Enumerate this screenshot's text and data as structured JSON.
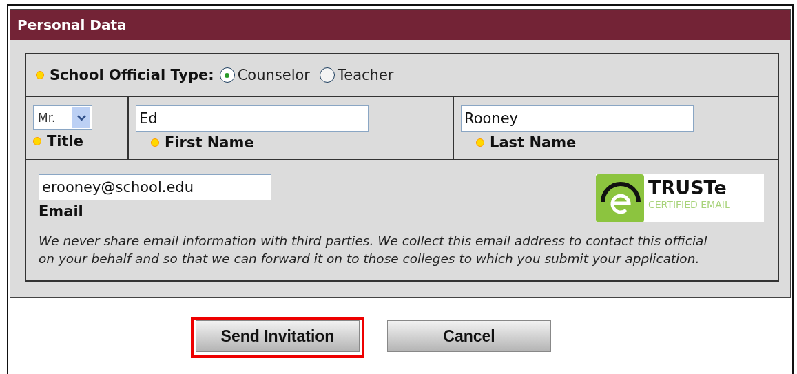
{
  "panel": {
    "title": "Personal Data"
  },
  "official_type": {
    "label": "School Official Type:",
    "required": true,
    "options": [
      {
        "label": "Counselor",
        "selected": true
      },
      {
        "label": "Teacher",
        "selected": false
      }
    ]
  },
  "name_fields": [
    {
      "kind": "select",
      "label": "Title",
      "value": "Mr.",
      "required": true
    },
    {
      "kind": "text",
      "label": "First Name",
      "value": "Ed",
      "required": true
    },
    {
      "kind": "text",
      "label": "Last Name",
      "value": "Rooney",
      "required": true
    }
  ],
  "email": {
    "label": "Email",
    "value": "erooney@school.edu",
    "required": false
  },
  "seal": {
    "name": "TRUSTe",
    "caption": "CERTIFIED EMAIL"
  },
  "note": "We never share email information with third parties. We collect this email address to contact this official on your behalf and so that we can forward it on to those colleges to which you submit your application.",
  "buttons": [
    {
      "label": "Send Invitation",
      "highlighted": true
    },
    {
      "label": "Cancel",
      "highlighted": false
    }
  ]
}
